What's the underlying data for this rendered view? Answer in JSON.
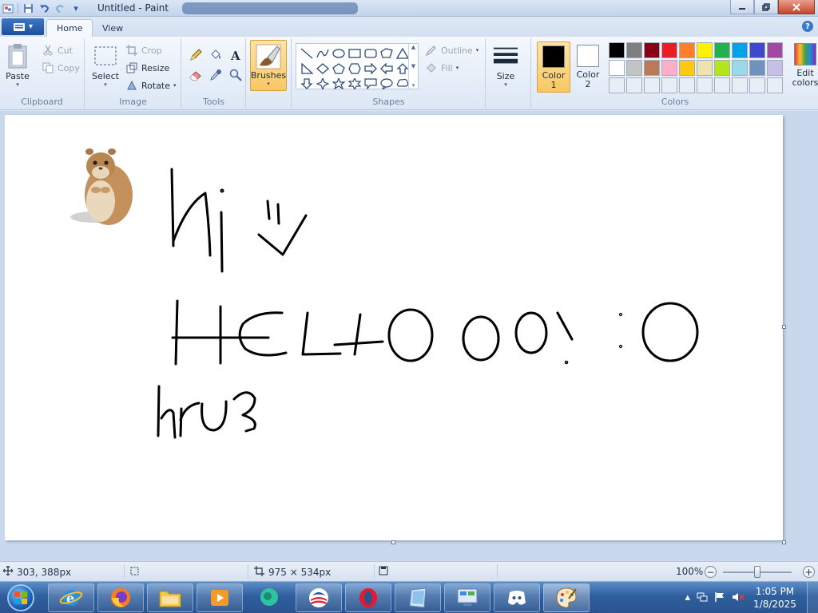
{
  "window": {
    "title": "Untitled - Paint"
  },
  "tabs": [
    {
      "label": "Home",
      "active": true
    },
    {
      "label": "View",
      "active": false
    }
  ],
  "ribbon": {
    "clipboard": {
      "label": "Clipboard",
      "paste": "Paste",
      "cut": "Cut",
      "copy": "Copy"
    },
    "image": {
      "label": "Image",
      "select": "Select",
      "crop": "Crop",
      "resize": "Resize",
      "rotate": "Rotate"
    },
    "tools": {
      "label": "Tools"
    },
    "brushes": {
      "label": "Brushes"
    },
    "shapes": {
      "label": "Shapes",
      "outline": "Outline",
      "fill": "Fill"
    },
    "size": {
      "label": "Size"
    },
    "colors": {
      "label": "Colors",
      "color1_label": "Color",
      "color1_num": "1",
      "color2_label": "Color",
      "color2_num": "2",
      "edit_label": "Edit",
      "edit_label2": "colors",
      "color1": "#000000",
      "color2": "#ffffff",
      "palette_row1": [
        "#000000",
        "#7f7f7f",
        "#880015",
        "#ed1c24",
        "#ff7f27",
        "#fff200",
        "#22b14c",
        "#00a2e8",
        "#3f48cc",
        "#a349a4"
      ],
      "palette_row2": [
        "#ffffff",
        "#c3c3c3",
        "#b97a57",
        "#ffaec9",
        "#ffc90e",
        "#efe4b0",
        "#b5e61d",
        "#99d9ea",
        "#7092be",
        "#c8bfe7"
      ],
      "palette_row3": [
        "#e8eef6",
        "#e8eef6",
        "#e8eef6",
        "#e8eef6",
        "#e8eef6",
        "#e8eef6",
        "#e8eef6",
        "#e8eef6",
        "#e8eef6",
        "#e8eef6"
      ]
    }
  },
  "canvas": {
    "drawing_text": [
      "Hi",
      "HELLOOO!",
      "hru?"
    ]
  },
  "status": {
    "cursor_pos": "303, 388px",
    "canvas_size": "975 × 534px",
    "zoom": "100%",
    "zoom_fraction": 0.5
  },
  "taskbar": {
    "time": "1:05 PM",
    "date": "1/8/2025"
  }
}
